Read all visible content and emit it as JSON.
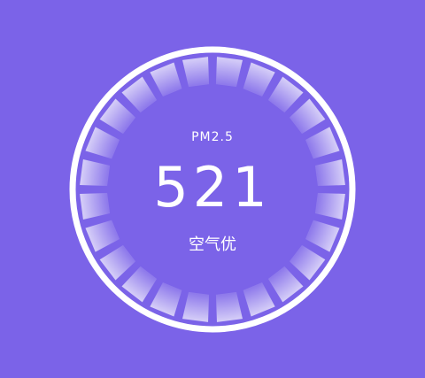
{
  "gauge": {
    "metric_label": "PM2.5",
    "value": "521",
    "quality_label": "空气优"
  },
  "colors": {
    "background": "#7b63e8",
    "ring": "#ffffff",
    "segment_fill": "#ffffff"
  }
}
